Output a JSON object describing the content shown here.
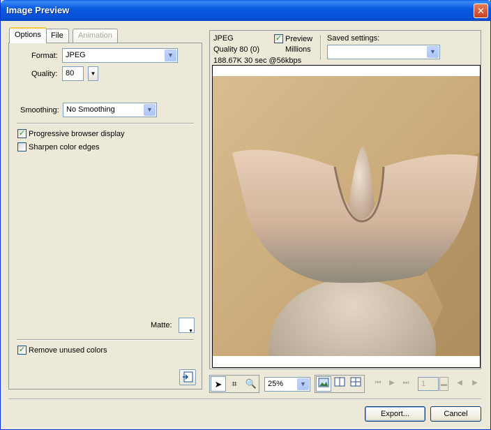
{
  "window": {
    "title": "Image Preview",
    "close_glyph": "✕"
  },
  "tabs": [
    {
      "label": "Options",
      "state": "active"
    },
    {
      "label": "File",
      "state": "normal"
    },
    {
      "label": "Animation",
      "state": "disabled"
    }
  ],
  "options": {
    "format_label": "Format:",
    "format_value": "JPEG",
    "quality_label": "Quality:",
    "quality_value": "80",
    "smoothing_label": "Smoothing:",
    "smoothing_value": "No Smoothing",
    "progressive_label": "Progressive browser display",
    "progressive_checked": true,
    "sharpen_label": "Sharpen color edges",
    "sharpen_checked": false,
    "matte_label": "Matte:",
    "remove_unused_label": "Remove unused colors",
    "remove_unused_checked": true
  },
  "preview_info": {
    "format": "JPEG",
    "quality": "Quality 80 (0)",
    "size_time": "188.67K  30 sec @56kbps",
    "preview_label": "Preview",
    "preview_checked": true,
    "colors": "Millions",
    "saved_settings_label": "Saved settings:",
    "saved_settings_value": ""
  },
  "toolbar": {
    "zoom_value": "25%",
    "frame_value": "1"
  },
  "buttons": {
    "export_label": "Export...",
    "cancel_label": "Cancel"
  },
  "colors": {
    "titlebar": "#0a5ae0",
    "dialog_bg": "#ece9d8",
    "check_green": "#21a121",
    "image_bg": "#cfb084"
  }
}
